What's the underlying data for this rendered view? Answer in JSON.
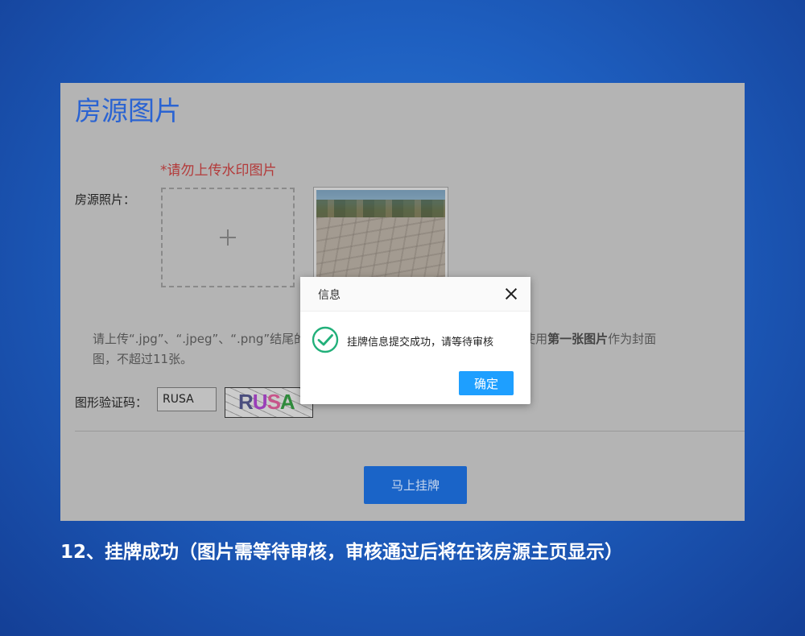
{
  "page": {
    "title": "房源图片",
    "warning": "*请勿上传水印图片",
    "photo_label": "房源照片：",
    "note_before": "请上传“.jpg”、“.jpeg”、“.png”结尾的",
    "note_middle": "器，默认使用",
    "note_bold": "第一张图片",
    "note_after": "作为封面",
    "note_line2": "图，不超过11张。",
    "captcha_label": "图形验证码：",
    "captcha_value": "RUSA",
    "captcha_image_text": [
      "R",
      "U",
      "S",
      "A"
    ],
    "submit_label": "马上挂牌"
  },
  "dialog": {
    "title": "信息",
    "message": "挂牌信息提交成功，请等待审核",
    "confirm_label": "确定",
    "accent_color": "#1e9fff",
    "success_color": "#22b07a"
  },
  "caption": "12、挂牌成功（图片需等待审核，审核通过后将在该房源主页显示）"
}
